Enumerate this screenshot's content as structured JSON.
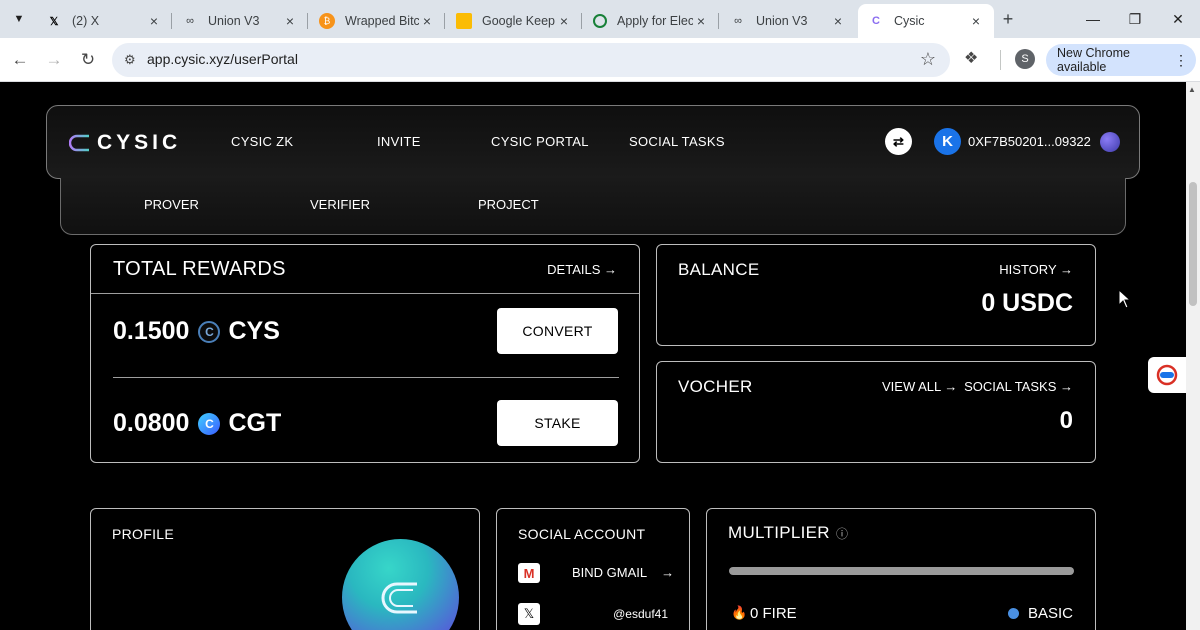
{
  "browser": {
    "tabs": [
      {
        "title": "(2) X",
        "favicon": "x-logo-icon"
      },
      {
        "title": "Union V3",
        "favicon": "union-icon"
      },
      {
        "title": "Wrapped Bitcoi",
        "favicon": "bitcoin-icon"
      },
      {
        "title": "Google Keep",
        "favicon": "keep-icon"
      },
      {
        "title": "Apply for Elec",
        "favicon": "apply-icon"
      },
      {
        "title": "Union V3",
        "favicon": "union-icon"
      },
      {
        "title": "Cysic",
        "favicon": "cysic-icon",
        "active": true
      }
    ],
    "url": "app.cysic.xyz/userPortal",
    "profile_initial": "S",
    "update_label": "New Chrome available"
  },
  "nav": {
    "logo_text": "CYSIC",
    "links": [
      "CYSIC ZK",
      "INVITE",
      "CYSIC PORTAL",
      "SOCIAL TASKS"
    ],
    "user_initial": "K",
    "wallet": "0XF7B50201...09322"
  },
  "subnav": {
    "links": [
      "PROVER",
      "VERIFIER",
      "PROJECT"
    ]
  },
  "rewards": {
    "title": "TOTAL REWARDS",
    "details_label": "DETAILS",
    "cys_amount": "0.1500",
    "cys_symbol": "CYS",
    "convert_label": "CONVERT",
    "cgt_amount": "0.0800",
    "cgt_symbol": "CGT",
    "stake_label": "STAKE"
  },
  "balance": {
    "title": "BALANCE",
    "history_label": "HISTORY",
    "value": "0 USDC"
  },
  "voucher": {
    "title": "VOCHER",
    "view_all_label": "VIEW ALL",
    "social_tasks_label": "SOCIAL TASKS",
    "value": "0"
  },
  "profile": {
    "title": "PROFILE"
  },
  "social": {
    "title": "SOCIAL ACCOUNT",
    "gmail_label": "BIND GMAIL",
    "x_handle": "@esduf41"
  },
  "multiplier": {
    "title": "MULTIPLIER",
    "fire_label": "0 FIRE",
    "tier_label": "BASIC",
    "progress": 0
  },
  "colors": {
    "accent_blue": "#1a73e8",
    "basic_dot": "#4a90e2",
    "fire": "#f07c1a"
  }
}
